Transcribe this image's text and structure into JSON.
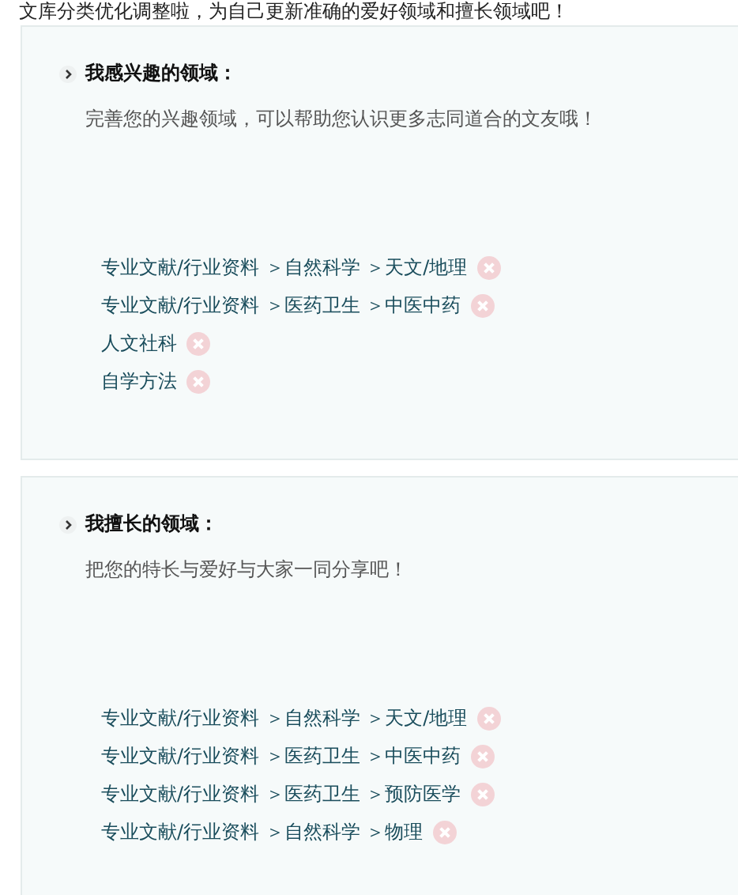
{
  "intro": "文库分类优化调整啦，为自己更新准确的爱好领域和擅长领域吧！",
  "sections": [
    {
      "title": "我感兴趣的领域：",
      "subtitle": "完善您的兴趣领域，可以帮助您认识更多志同道合的文友哦！",
      "items": [
        {
          "text": "专业文献/行业资料 ＞自然科学 ＞天文/地理"
        },
        {
          "text": "专业文献/行业资料 ＞医药卫生 ＞中医中药"
        },
        {
          "text": "人文社科"
        },
        {
          "text": "自学方法"
        }
      ]
    },
    {
      "title": "我擅长的领域：",
      "subtitle": "把您的特长与爱好与大家一同分享吧！",
      "items": [
        {
          "text": "专业文献/行业资料 ＞自然科学 ＞天文/地理"
        },
        {
          "text": "专业文献/行业资料 ＞医药卫生 ＞中医中药"
        },
        {
          "text": "专业文献/行业资料 ＞医药卫生 ＞预防医学"
        },
        {
          "text": "专业文献/行业资料 ＞自然科学 ＞物理"
        }
      ]
    }
  ]
}
